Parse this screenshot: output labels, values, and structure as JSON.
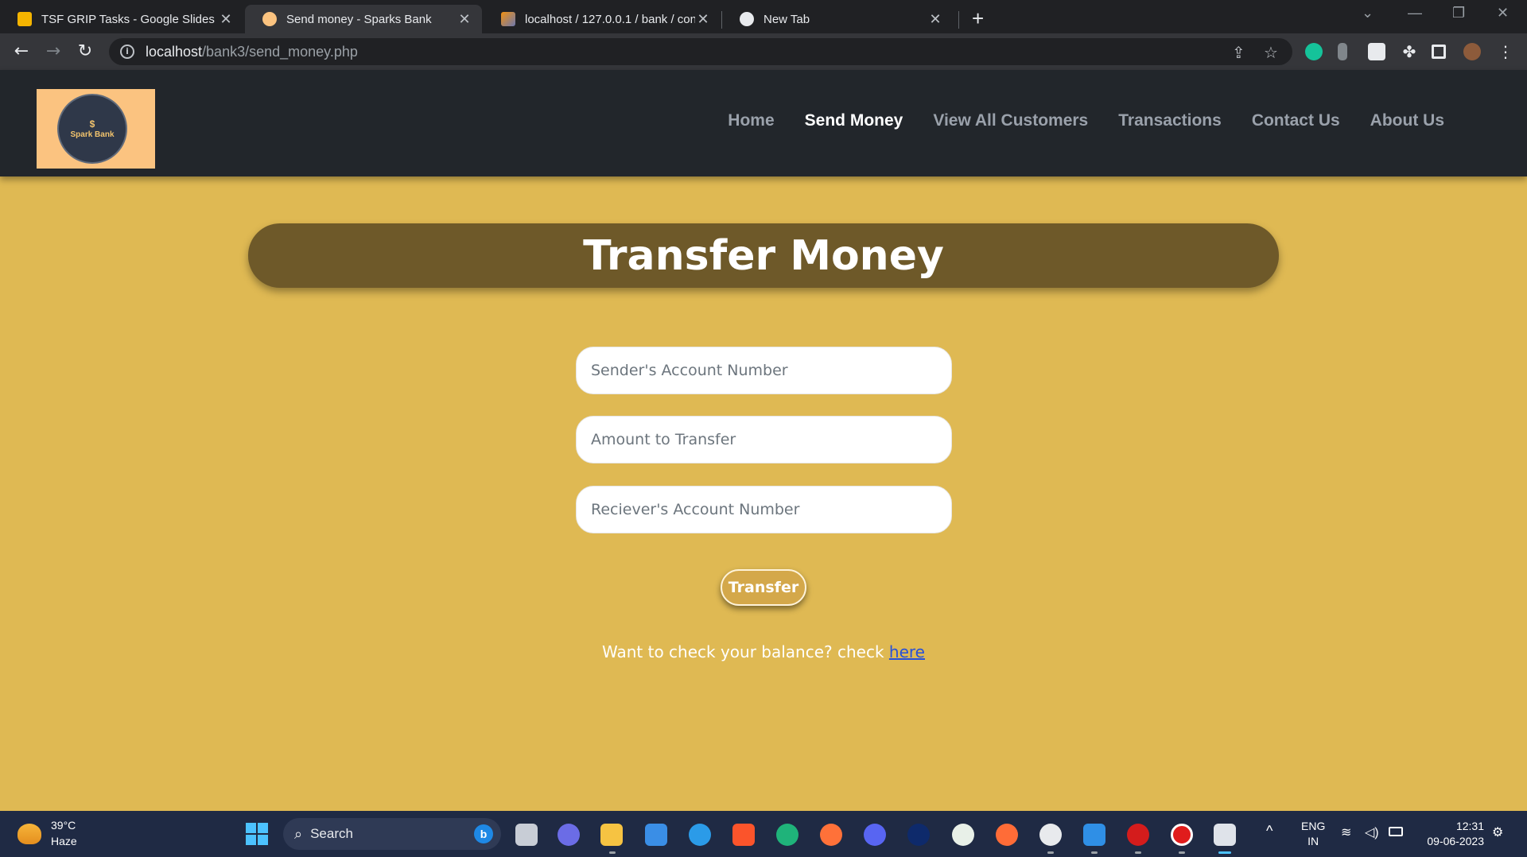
{
  "browser": {
    "tabs": [
      {
        "title": "TSF GRIP Tasks - Google Slides",
        "favicon": "slides-icon",
        "active": false
      },
      {
        "title": "Send money - Sparks Bank",
        "favicon": "sparks-bank-icon",
        "active": true
      },
      {
        "title": "localhost / 127.0.0.1 / bank / con",
        "favicon": "phpmyadmin-icon",
        "active": false
      },
      {
        "title": "New Tab",
        "favicon": "chrome-icon",
        "active": false
      }
    ],
    "url_host": "localhost",
    "url_path": "/bank3/send_money.php"
  },
  "site": {
    "logo": {
      "symbol": "$",
      "name": "Spark Bank"
    },
    "nav": [
      {
        "label": "Home",
        "current": false
      },
      {
        "label": "Send Money",
        "current": true
      },
      {
        "label": "View All Customers",
        "current": false
      },
      {
        "label": "Transactions",
        "current": false
      },
      {
        "label": "Contact Us",
        "current": false
      },
      {
        "label": "About Us",
        "current": false
      }
    ]
  },
  "main": {
    "title": "Transfer Money",
    "fields": {
      "sender_placeholder": "Sender's Account Number",
      "amount_placeholder": "Amount to Transfer",
      "receiver_placeholder": "Reciever's Account Number"
    },
    "transfer_label": "Transfer",
    "balance_text": "Want to check your balance? check ",
    "balance_link": "here"
  },
  "taskbar": {
    "weather_temp": "39°C",
    "weather_cond": "Haze",
    "search_label": "Search",
    "lang_top": "ENG",
    "lang_bottom": "IN",
    "time": "12:31",
    "date": "09-06-2023"
  },
  "colors": {
    "page_bg": "#dfb953",
    "title_bar": "#6e5929",
    "nav_bg": "#22262b",
    "logo_bg": "#fbc380",
    "button": "#d4a84a",
    "link": "#2750d8"
  }
}
